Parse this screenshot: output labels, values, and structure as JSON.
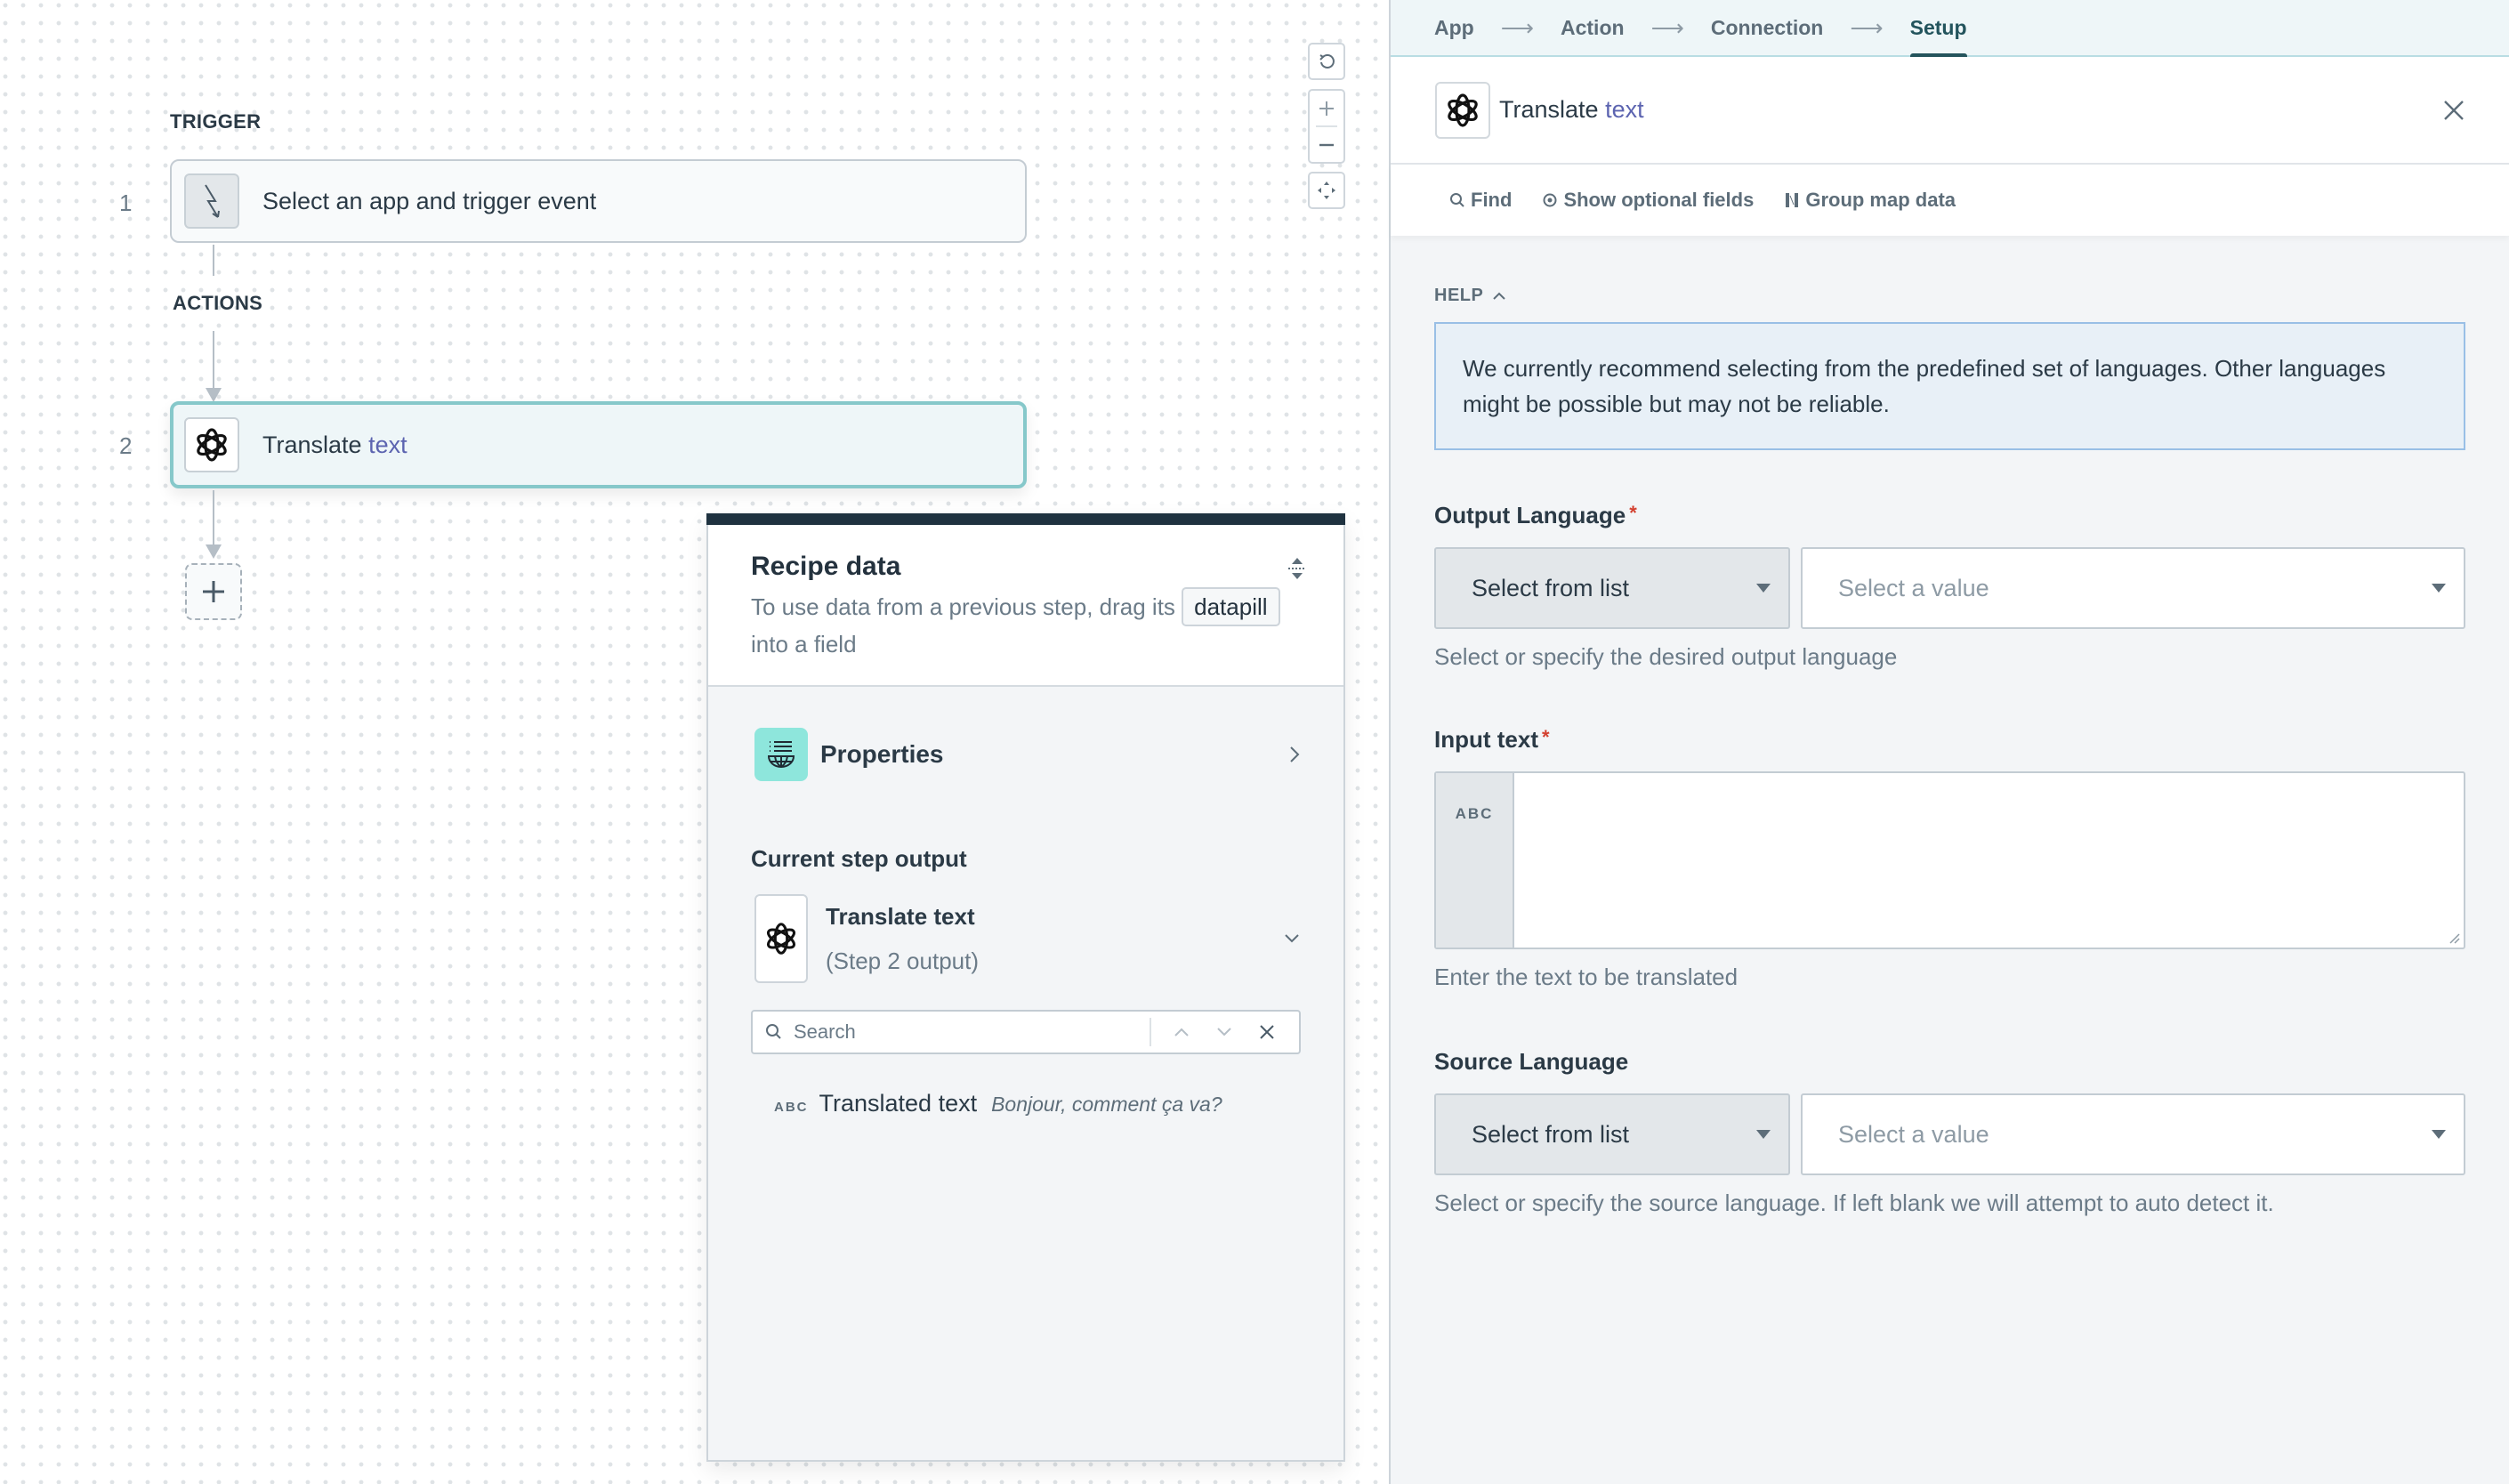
{
  "canvas": {
    "trigger_label": "TRIGGER",
    "actions_label": "ACTIONS",
    "steps": [
      {
        "number": "1",
        "title": "Select an app and trigger event",
        "title_accent": "",
        "icon": "trigger-bolt-icon"
      },
      {
        "number": "2",
        "title": "Translate ",
        "title_accent": "text",
        "icon": "openai-icon"
      }
    ],
    "zoom_controls": {
      "reset": "reset-view-icon",
      "zoom_in": "plus-icon",
      "zoom_out": "minus-icon",
      "fit": "fit-to-screen-icon"
    }
  },
  "recipe_data": {
    "title": "Recipe data",
    "description_before": "To use data from a previous step, drag its ",
    "pill_word": "datapill",
    "description_after": " into a field",
    "properties_label": "Properties",
    "current_step_output_label": "Current step output",
    "step_output": {
      "title": "Translate text",
      "subtitle": "(Step 2 output)"
    },
    "search": {
      "placeholder": "Search",
      "value": ""
    },
    "datapills": [
      {
        "type": "ABC",
        "name": "Translated text",
        "sample": "Bonjour, comment ça va?"
      }
    ]
  },
  "panel": {
    "tabs": [
      {
        "label": "App",
        "active": false
      },
      {
        "label": "Action",
        "active": false
      },
      {
        "label": "Connection",
        "active": false
      },
      {
        "label": "Setup",
        "active": true
      }
    ],
    "tab_arrow": "⟶",
    "header": {
      "title": "Translate ",
      "title_accent": "text"
    },
    "toolbar": {
      "find": "Find",
      "show_optional": "Show optional fields",
      "group_map": "Group map data"
    },
    "help": {
      "label": "HELP",
      "text": "We currently recommend selecting from the predefined set of languages. Other languages might be possible but may not be reliable."
    },
    "fields": {
      "output_language": {
        "label": "Output Language",
        "required": "*",
        "mode": "Select from list",
        "placeholder": "Select a value",
        "hint": "Select or specify the desired output language"
      },
      "input_text": {
        "label": "Input text",
        "required": "*",
        "type_badge": "ABC",
        "value": "",
        "hint": "Enter the text to be translated"
      },
      "source_language": {
        "label": "Source Language",
        "mode": "Select from list",
        "placeholder": "Select a value",
        "hint": "Select or specify the source language. If left blank we will attempt to auto detect it."
      }
    }
  },
  "colors": {
    "accent_text": "#5c64b0",
    "active_card_border": "#86c8ca",
    "help_box_bg": "#e8f0f7",
    "help_box_border": "#99bfe6",
    "required": "#d3402f",
    "properties_icon_bg": "#8ee6dc",
    "recipe_topbar": "#1f3240"
  }
}
